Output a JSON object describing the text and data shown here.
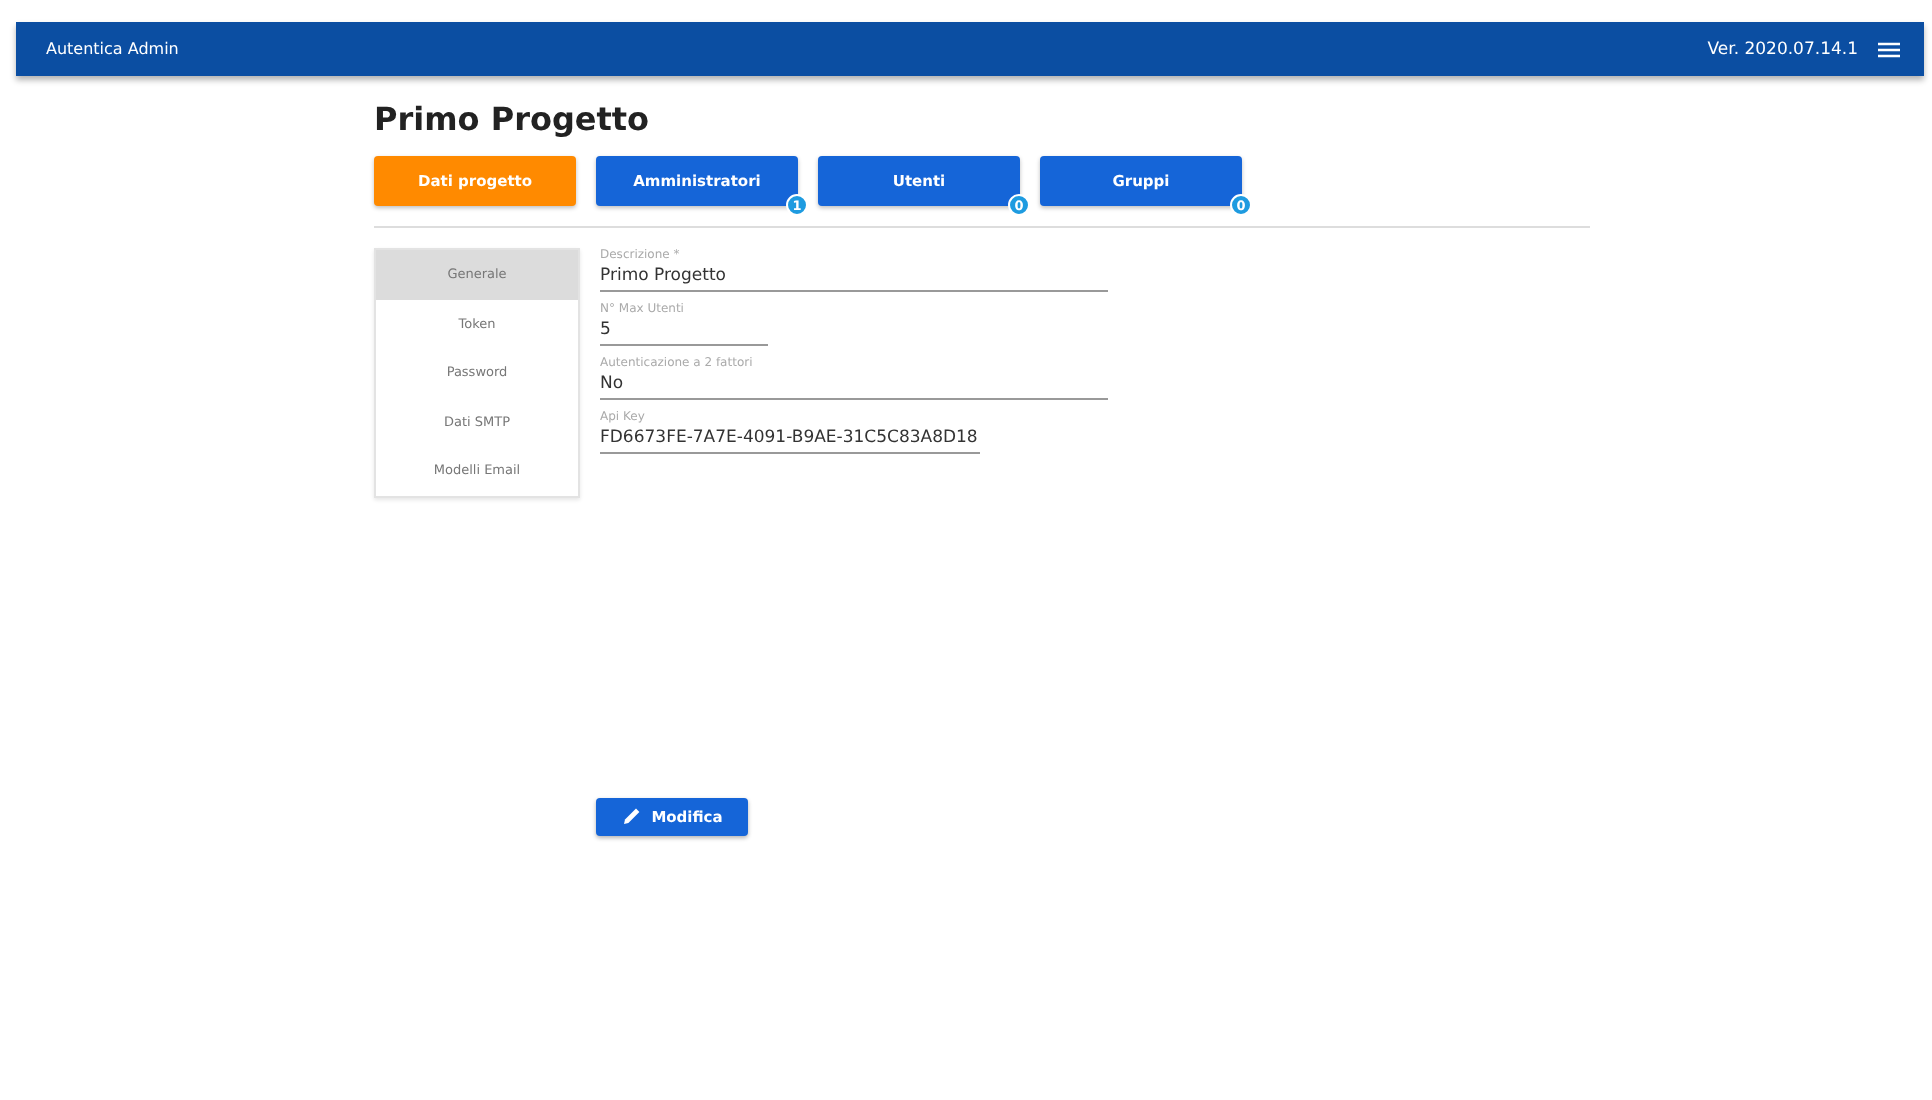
{
  "header": {
    "title": "Autentica Admin",
    "version": "Ver. 2020.07.14.1"
  },
  "page_title": "Primo Progetto",
  "tabs": [
    {
      "label": "Dati progetto",
      "selected": true
    },
    {
      "label": "Amministratori",
      "selected": false,
      "badge": "1"
    },
    {
      "label": "Utenti",
      "selected": false,
      "badge": "0"
    },
    {
      "label": "Gruppi",
      "selected": false,
      "badge": "0"
    }
  ],
  "sidebar": {
    "items": [
      {
        "label": "Generale",
        "selected": true
      },
      {
        "label": "Token",
        "selected": false
      },
      {
        "label": "Password",
        "selected": false
      },
      {
        "label": "Dati SMTP",
        "selected": false
      },
      {
        "label": "Modelli Email",
        "selected": false
      }
    ]
  },
  "fields": [
    {
      "label": "Descrizione *",
      "value": "Primo Progetto"
    },
    {
      "label": "N° Max Utenti",
      "value": "5"
    },
    {
      "label": "Autenticazione a 2 fattori",
      "value": "No"
    },
    {
      "label": "Api Key",
      "value": "FD6673FE-7A7E-4091-B9AE-31C5C83A8D18"
    }
  ],
  "edit_button": {
    "label": "Modifica"
  }
}
